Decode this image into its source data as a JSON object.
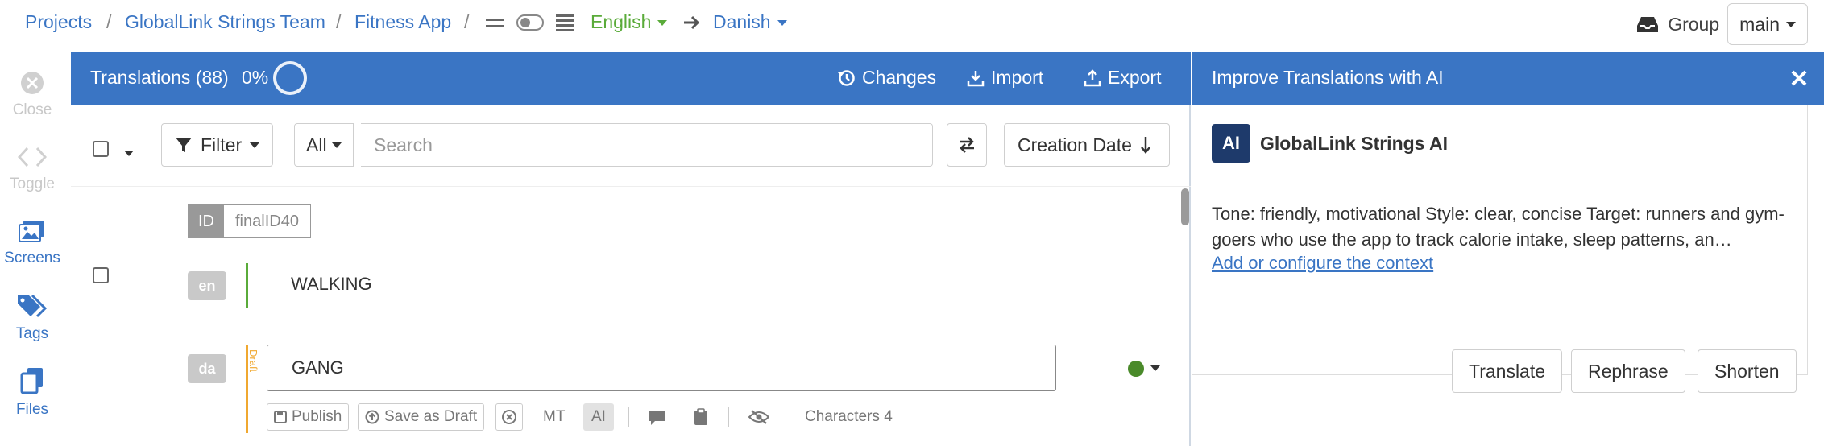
{
  "breadcrumb": {
    "projects": "Projects",
    "team": "GlobalLink Strings Team",
    "project": "Fitness App",
    "separator": "/"
  },
  "languages": {
    "source": "English",
    "target": "Danish"
  },
  "group": {
    "label": "Group",
    "branch": "main"
  },
  "rail": {
    "close": "Close",
    "toggle": "Toggle",
    "screens": "Screens",
    "tags": "Tags",
    "files": "Files"
  },
  "translations": {
    "title": "Translations (88)",
    "progress": "0%",
    "progress_value": 0,
    "changes": "Changes",
    "import": "Import",
    "export": "Export"
  },
  "filters": {
    "filter_label": "Filter",
    "scope": "All",
    "search_placeholder": "Search",
    "sort": "Creation Date"
  },
  "entry": {
    "id_key": "ID",
    "id_value": "finalID40",
    "source_lang": "en",
    "source_text": "WALKING",
    "target_lang": "da",
    "draft_label": "Draft",
    "target_text": "GANG",
    "publish": "Publish",
    "save_draft": "Save as Draft",
    "mt": "MT",
    "ai": "AI",
    "characters": "Characters 4"
  },
  "ai_panel": {
    "title": "Improve Translations with AI",
    "logo": "AI",
    "name": "GlobalLink Strings AI",
    "context": "Tone: friendly, motivational Style: clear, concise Target: runners and gym-goers who use the app to track calorie intake, sleep patterns, an…",
    "context_link": "Add or configure the context",
    "translate": "Translate",
    "rephrase": "Rephrase",
    "shorten": "Shorten"
  },
  "colors": {
    "accent": "#3a75c4",
    "source": "#5aab3a",
    "draft": "#f0a830",
    "status": "#4a8a2a"
  }
}
